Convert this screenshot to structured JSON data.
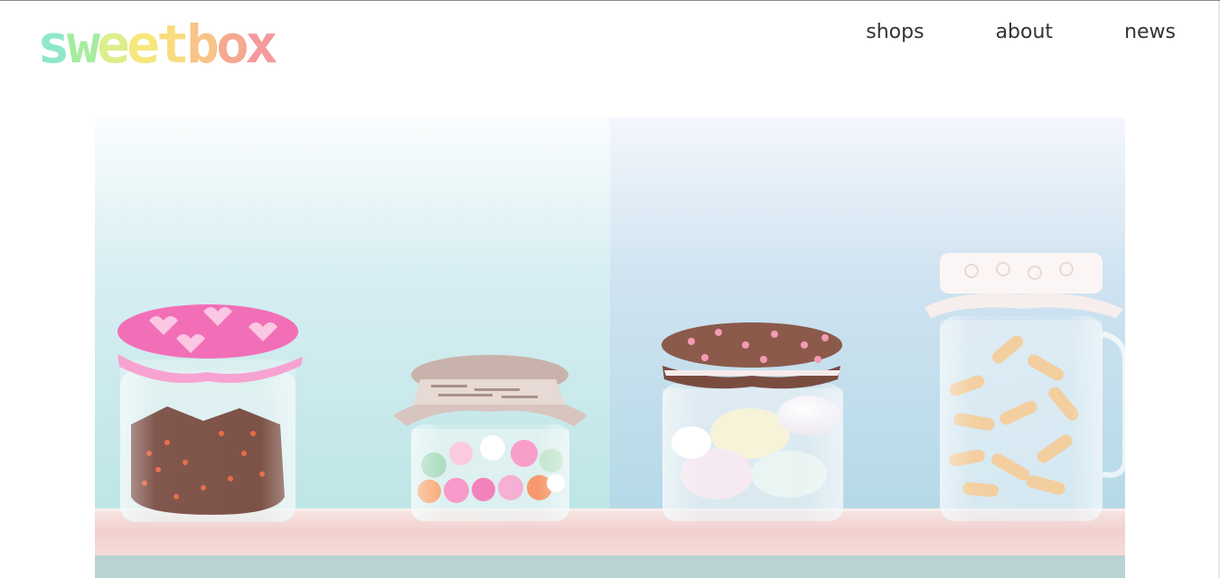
{
  "brand": {
    "name": "sweetbox",
    "letters": [
      {
        "ch": "s",
        "color": "#8ee8c8"
      },
      {
        "ch": "w",
        "color": "#a6ec9e"
      },
      {
        "ch": "e",
        "color": "#dcef8a"
      },
      {
        "ch": "e",
        "color": "#f6e77c"
      },
      {
        "ch": "t",
        "color": "#f9dc7e"
      },
      {
        "ch": "b",
        "color": "#f8c487"
      },
      {
        "ch": "o",
        "color": "#f5a98f"
      },
      {
        "ch": "x",
        "color": "#f49a9c"
      }
    ]
  },
  "nav": {
    "shops": "shops",
    "about": "about",
    "news": "news"
  },
  "hero": {
    "image": "candy-jars-photo",
    "colors": {
      "sky_top": "#f6fafc",
      "sky_left": "#c7ecee",
      "sky_right": "#b9dcea",
      "shelf": "#f4d6d4"
    }
  }
}
